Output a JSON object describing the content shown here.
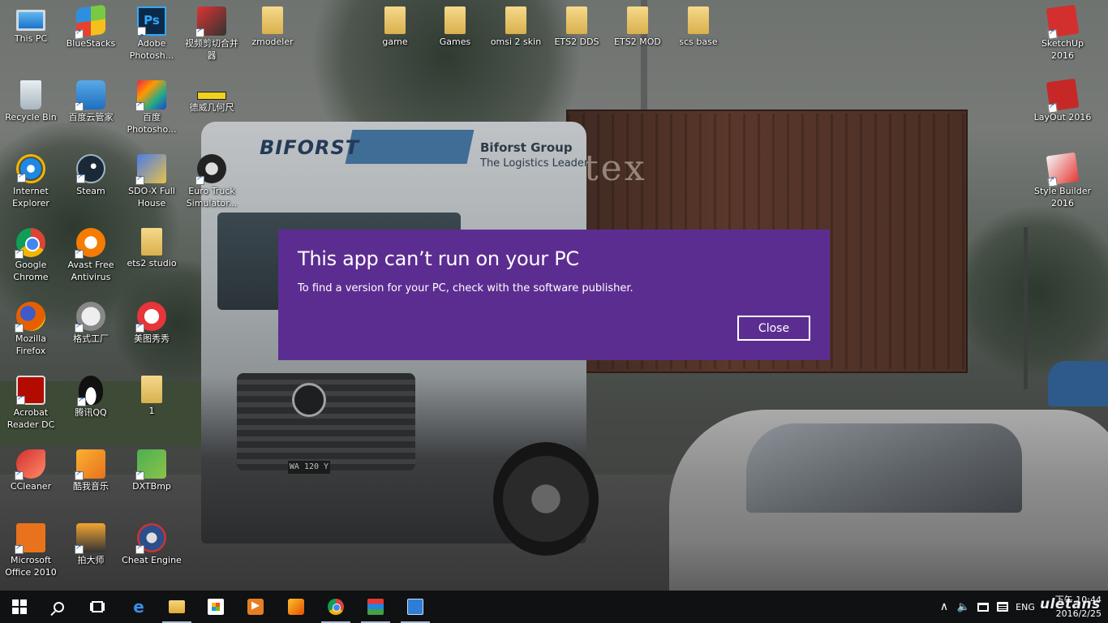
{
  "dialog": {
    "title": "This app can’t run on your PC",
    "message": "To find a version for your PC, check with the software publisher.",
    "close_label": "Close",
    "background_color": "#5c2d91"
  },
  "wallpaper": {
    "truck_brand": "BIFORST",
    "truck_company": "Biforst Group",
    "truck_tagline": "The Logistics Leader",
    "container_text": "tex",
    "plate": "WA 120 Y"
  },
  "desktop_icons": [
    {
      "label": "This PC",
      "icon": "computer-icon"
    },
    {
      "label": "BlueStacks",
      "icon": "bluestacks-icon"
    },
    {
      "label": "Adobe Photosh...",
      "icon": "photoshop-icon"
    },
    {
      "label": "视频剪切合并器",
      "icon": "video-cutter-icon"
    },
    {
      "label": "zmodeler",
      "icon": "folder-icon"
    },
    {
      "label": "game",
      "icon": "folder-icon"
    },
    {
      "label": "Games",
      "icon": "folder-icon"
    },
    {
      "label": "omsi 2 skin",
      "icon": "folder-icon"
    },
    {
      "label": "ETS2 DDS",
      "icon": "folder-icon"
    },
    {
      "label": "ETS2 MOD",
      "icon": "folder-icon"
    },
    {
      "label": "scs base",
      "icon": "folder-icon"
    },
    {
      "label": "SketchUp 2016",
      "icon": "sketchup-icon"
    },
    {
      "label": "Recycle Bin",
      "icon": "recycle-bin-icon"
    },
    {
      "label": "百度云管家",
      "icon": "baidu-cloud-icon"
    },
    {
      "label": "百度 Photosho...",
      "icon": "baidu-photoshop-icon"
    },
    {
      "label": "德威几何尺",
      "icon": "ruler-icon"
    },
    {
      "label": "LayOut 2016",
      "icon": "layout-icon"
    },
    {
      "label": "Internet Explorer",
      "icon": "internet-explorer-icon"
    },
    {
      "label": "Steam",
      "icon": "steam-icon"
    },
    {
      "label": "SDO-X Full House",
      "icon": "sdo-icon"
    },
    {
      "label": "Euro Truck Simulator...",
      "icon": "euro-truck-simulator-icon"
    },
    {
      "label": "Style Builder 2016",
      "icon": "style-builder-icon"
    },
    {
      "label": "Google Chrome",
      "icon": "chrome-icon"
    },
    {
      "label": "Avast Free Antivirus",
      "icon": "avast-icon"
    },
    {
      "label": "ets2 studio",
      "icon": "folder-icon"
    },
    {
      "label": "Mozilla Firefox",
      "icon": "firefox-icon"
    },
    {
      "label": "格式工厂",
      "icon": "format-factory-icon"
    },
    {
      "label": "美图秀秀",
      "icon": "meitu-icon"
    },
    {
      "label": "Acrobat Reader DC",
      "icon": "acrobat-icon"
    },
    {
      "label": "腾讯QQ",
      "icon": "qq-icon"
    },
    {
      "label": "1",
      "icon": "folder-icon"
    },
    {
      "label": "CCleaner",
      "icon": "ccleaner-icon"
    },
    {
      "label": "酷我音乐",
      "icon": "kuwo-music-icon"
    },
    {
      "label": "DXTBmp",
      "icon": "dxtbmp-icon"
    },
    {
      "label": "Microsoft Office 2010",
      "icon": "office-icon"
    },
    {
      "label": "拍大师",
      "icon": "pai-dashi-icon"
    },
    {
      "label": "Cheat Engine",
      "icon": "cheat-engine-icon"
    }
  ],
  "taskbar": {
    "pinned": [
      {
        "name": "start-button",
        "icon": "windows-logo-icon"
      },
      {
        "name": "search-button",
        "icon": "search-icon"
      },
      {
        "name": "task-view-button",
        "icon": "task-view-icon"
      },
      {
        "name": "taskbar-edge",
        "icon": "edge-icon",
        "glyph": "e"
      },
      {
        "name": "taskbar-file-explorer",
        "icon": "file-explorer-icon"
      },
      {
        "name": "taskbar-store",
        "icon": "store-icon"
      },
      {
        "name": "taskbar-media-player",
        "icon": "media-player-icon"
      },
      {
        "name": "taskbar-kuwo",
        "icon": "kuwo-icon"
      },
      {
        "name": "taskbar-chrome",
        "icon": "chrome-icon"
      },
      {
        "name": "taskbar-flag-app",
        "icon": "flag-app-icon"
      },
      {
        "name": "taskbar-app",
        "icon": "app-icon"
      }
    ],
    "tray": {
      "chevron": "∧",
      "volume": "🔈",
      "language": "ENG",
      "time": "下午 10:44",
      "date": "2016/2/25"
    },
    "watermark": "uletans"
  }
}
